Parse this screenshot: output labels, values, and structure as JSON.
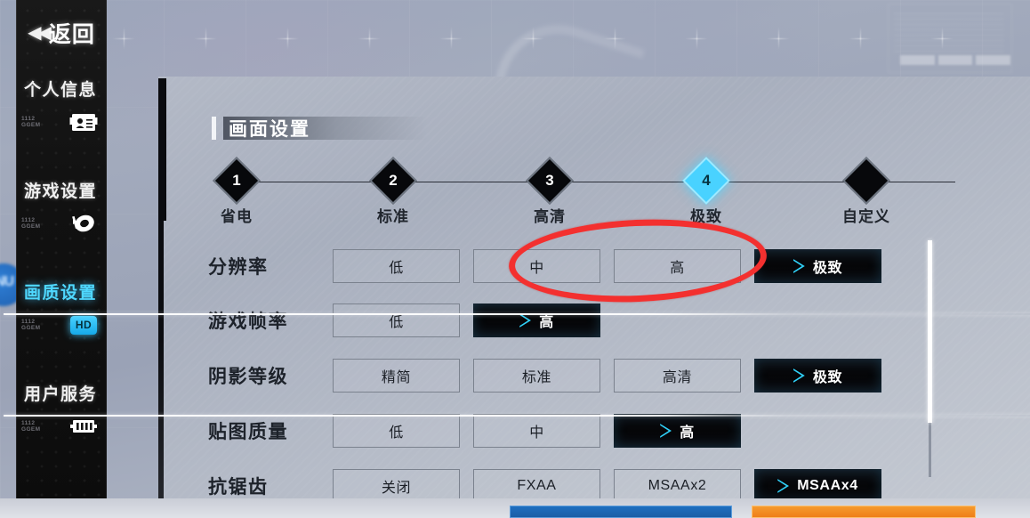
{
  "sidebar": {
    "back": {
      "label": "返回",
      "icon": "double-chevron-left-icon"
    },
    "items": [
      {
        "label": "个人信息",
        "icon": "id-card-icon",
        "ghost": "1112\nGGEM",
        "active": false
      },
      {
        "label": "游戏设置",
        "icon": "gear-coin-icon",
        "ghost": "1112\nGGEM",
        "active": false
      },
      {
        "label": "画质设置",
        "icon": "hd-badge-icon",
        "ghost": "1112\nGGEM",
        "active": true,
        "badge": "HD"
      },
      {
        "label": "用户服务",
        "icon": "server-rack-icon",
        "ghost": "1112\nGGEM",
        "active": false
      }
    ]
  },
  "panel": {
    "title": "画面设置",
    "stepper": [
      {
        "num": "1",
        "label": "省电",
        "active": false,
        "plain": false
      },
      {
        "num": "2",
        "label": "标准",
        "active": false,
        "plain": false
      },
      {
        "num": "3",
        "label": "高清",
        "active": false,
        "plain": false
      },
      {
        "num": "4",
        "label": "极致",
        "active": true,
        "plain": false
      },
      {
        "num": "",
        "label": "自定义",
        "active": false,
        "plain": true
      }
    ],
    "rows": [
      {
        "label": "分辨率",
        "options": [
          {
            "text": "低",
            "selected": false
          },
          {
            "text": "中",
            "selected": false
          },
          {
            "text": "高",
            "selected": false
          },
          {
            "text": "极致",
            "selected": true
          }
        ]
      },
      {
        "label": "游戏帧率",
        "options": [
          {
            "text": "低",
            "selected": false
          },
          {
            "text": "高",
            "selected": true
          }
        ]
      },
      {
        "label": "阴影等级",
        "options": [
          {
            "text": "精简",
            "selected": false
          },
          {
            "text": "标准",
            "selected": false
          },
          {
            "text": "高清",
            "selected": false
          },
          {
            "text": "极致",
            "selected": true
          }
        ]
      },
      {
        "label": "贴图质量",
        "options": [
          {
            "text": "低",
            "selected": false
          },
          {
            "text": "中",
            "selected": false
          },
          {
            "text": "高",
            "selected": true
          }
        ]
      },
      {
        "label": "抗锯齿",
        "options": [
          {
            "text": "关闭",
            "selected": false
          },
          {
            "text": "FXAA",
            "selected": false
          },
          {
            "text": "MSAAx2",
            "selected": false
          },
          {
            "text": "MSAAx4",
            "selected": true
          }
        ]
      }
    ]
  },
  "bottom_bar": {
    "primary_color": "#1f6fc0",
    "secondary_color": "#f59a2e"
  },
  "annotation": {
    "shape": "ellipse",
    "color": "#f3302f",
    "highlights": [
      "中",
      "高"
    ]
  },
  "colors": {
    "accent_cyan": "#49d2ff",
    "panel_bg": "#b3b9c6",
    "sidebar_bg": "#111111"
  },
  "scrollbar": {
    "visible": true
  }
}
